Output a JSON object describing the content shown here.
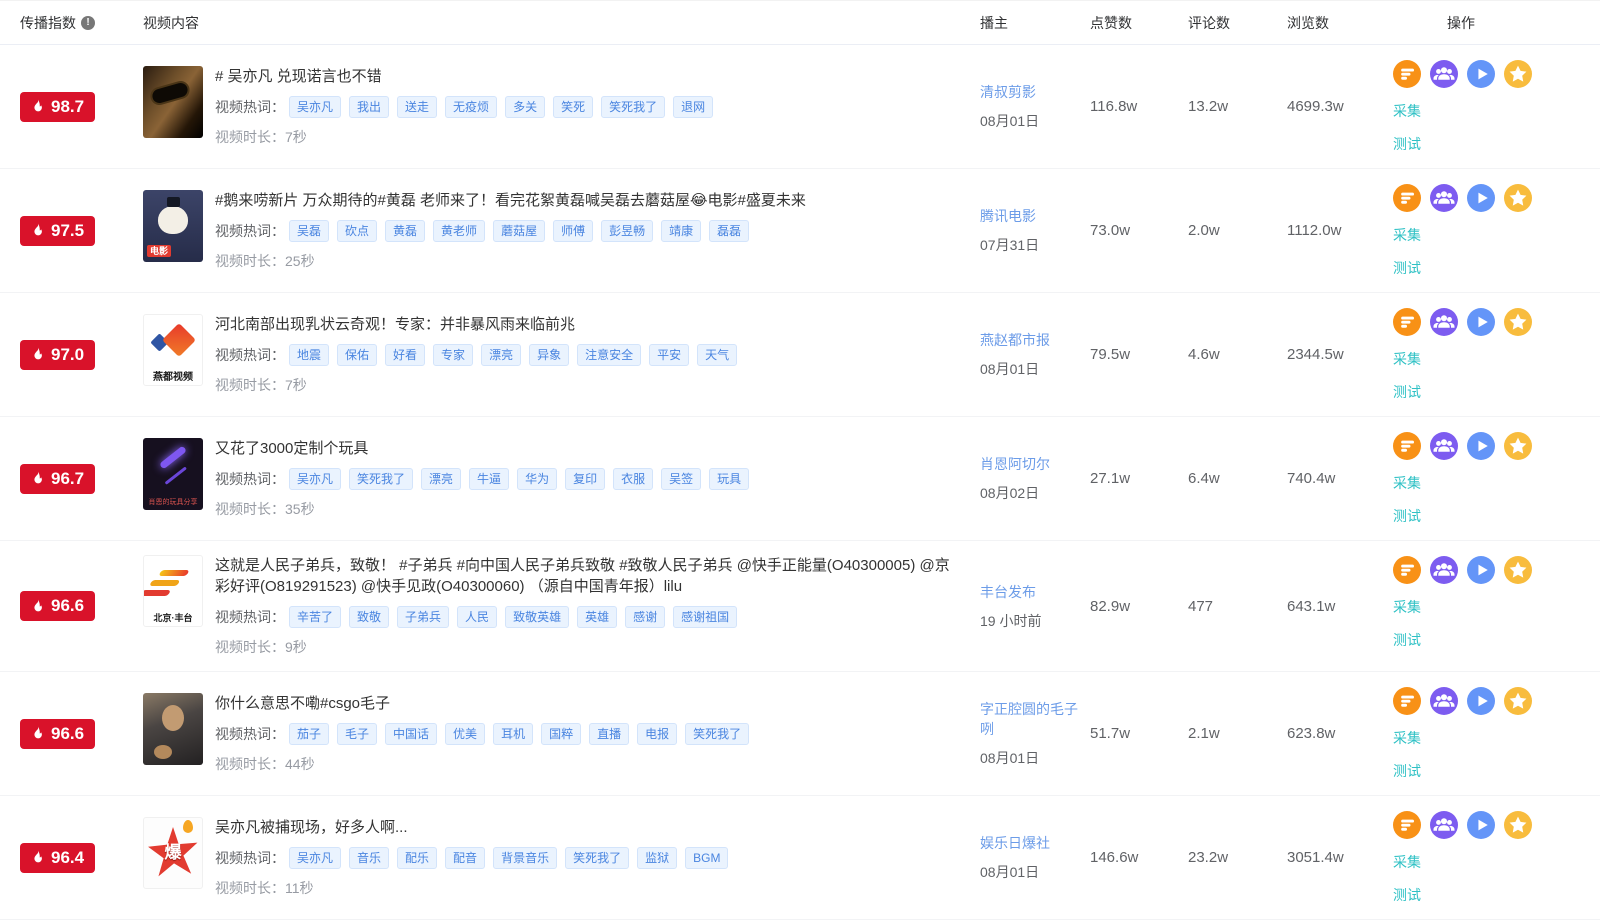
{
  "header": {
    "columns": [
      {
        "label": "传播指数"
      },
      {
        "label": "视频内容"
      },
      {
        "label": "播主"
      },
      {
        "label": "点赞数"
      },
      {
        "label": "评论数"
      },
      {
        "label": "浏览数"
      },
      {
        "label": "操作"
      }
    ],
    "info_icon": "!"
  },
  "labels": {
    "hot_words": "视频热词：",
    "duration_prefix": "视频时长：",
    "collect": "采集",
    "test": "测试"
  },
  "colors": {
    "badge_red": "#d9122a",
    "tag_blue": "#4a85e0",
    "tag_bg": "#eaf3fe",
    "link_blue": "#6c9ce8",
    "teal": "#2fc1c5",
    "icon_orange": "#f89116",
    "icon_purple": "#7d5cf0",
    "icon_blue": "#6495f8",
    "icon_yellow": "#f8bc3d"
  },
  "action_icons": [
    "list-icon",
    "group-icon",
    "play-icon",
    "star-icon"
  ],
  "rows": [
    {
      "index": "98.7",
      "title": "# 吴亦凡 兑现诺言也不错",
      "hot_words": [
        "吴亦凡",
        "我出",
        "送走",
        "无疫烦",
        "多关",
        "笑死",
        "笑死我了",
        "退网"
      ],
      "duration": "7秒",
      "creator": "清叔剪影",
      "date": "08月01日",
      "likes": "116.8w",
      "comments": "13.2w",
      "views": "4699.3w",
      "thumb": {
        "kind": "leon",
        "text": ""
      }
    },
    {
      "index": "97.5",
      "title": "#鹅来唠新片 万众期待的#黄磊 老师来了！看完花絮黄磊喊吴磊去蘑菇屋😂电影#盛夏未来",
      "hot_words": [
        "吴磊",
        "砍点",
        "黄磊",
        "黄老师",
        "蘑菇屋",
        "师傅",
        "彭昱畅",
        "靖康",
        "磊磊"
      ],
      "duration": "25秒",
      "creator": "腾讯电影",
      "date": "07月31日",
      "likes": "73.0w",
      "comments": "2.0w",
      "views": "1112.0w",
      "thumb": {
        "kind": "penguin",
        "text": "电影"
      }
    },
    {
      "index": "97.0",
      "title": "河北南部出现乳状云奇观！专家：并非暴风雨来临前兆",
      "hot_words": [
        "地震",
        "保佑",
        "好看",
        "专家",
        "漂亮",
        "异象",
        "注意安全",
        "平安",
        "天气"
      ],
      "duration": "7秒",
      "creator": "燕赵都市报",
      "date": "08月01日",
      "likes": "79.5w",
      "comments": "4.6w",
      "views": "2344.5w",
      "thumb": {
        "kind": "yandu",
        "text": "燕都视频"
      }
    },
    {
      "index": "96.7",
      "title": "又花了3000定制个玩具",
      "hot_words": [
        "吴亦凡",
        "笑死我了",
        "漂亮",
        "牛逼",
        "华为",
        "复印",
        "衣服",
        "吴签",
        "玩具"
      ],
      "duration": "35秒",
      "creator": "肖恩阿切尔",
      "date": "08月02日",
      "likes": "27.1w",
      "comments": "6.4w",
      "views": "740.4w",
      "thumb": {
        "kind": "toy",
        "text": "肖恩的玩具分享"
      }
    },
    {
      "index": "96.6",
      "title": "这就是人民子弟兵，致敬！ #子弟兵 #向中国人民子弟兵致敬 #致敬人民子弟兵 @快手正能量(O40300005) @京彩好评(O819291523) @快手见政(O40300060) （源自中国青年报）lilu",
      "hot_words": [
        "辛苦了",
        "致敬",
        "子弟兵",
        "人民",
        "致敬英雄",
        "英雄",
        "感谢",
        "感谢祖国"
      ],
      "duration": "9秒",
      "creator": "丰台发布",
      "date": "19 小时前",
      "likes": "82.9w",
      "comments": "477",
      "views": "643.1w",
      "thumb": {
        "kind": "fengtai",
        "text": "北京·丰台"
      }
    },
    {
      "index": "96.6",
      "title": "你什么意思不嘞#csgo毛子",
      "hot_words": [
        "茄子",
        "毛子",
        "中国话",
        "优美",
        "耳机",
        "国粹",
        "直播",
        "电报",
        "笑死我了"
      ],
      "duration": "44秒",
      "creator": "字正腔圆的毛子咧",
      "date": "08月01日",
      "likes": "51.7w",
      "comments": "2.1w",
      "views": "623.8w",
      "thumb": {
        "kind": "hoodie",
        "text": ""
      }
    },
    {
      "index": "96.4",
      "title": "吴亦凡被捕现场，好多人啊...",
      "hot_words": [
        "吴亦凡",
        "音乐",
        "配乐",
        "配音",
        "背景音乐",
        "笑死我了",
        "监狱",
        "BGM"
      ],
      "duration": "11秒",
      "creator": "娱乐日爆社",
      "date": "08月01日",
      "likes": "146.6w",
      "comments": "23.2w",
      "views": "3051.4w",
      "thumb": {
        "kind": "burst",
        "text": "爆"
      }
    }
  ]
}
